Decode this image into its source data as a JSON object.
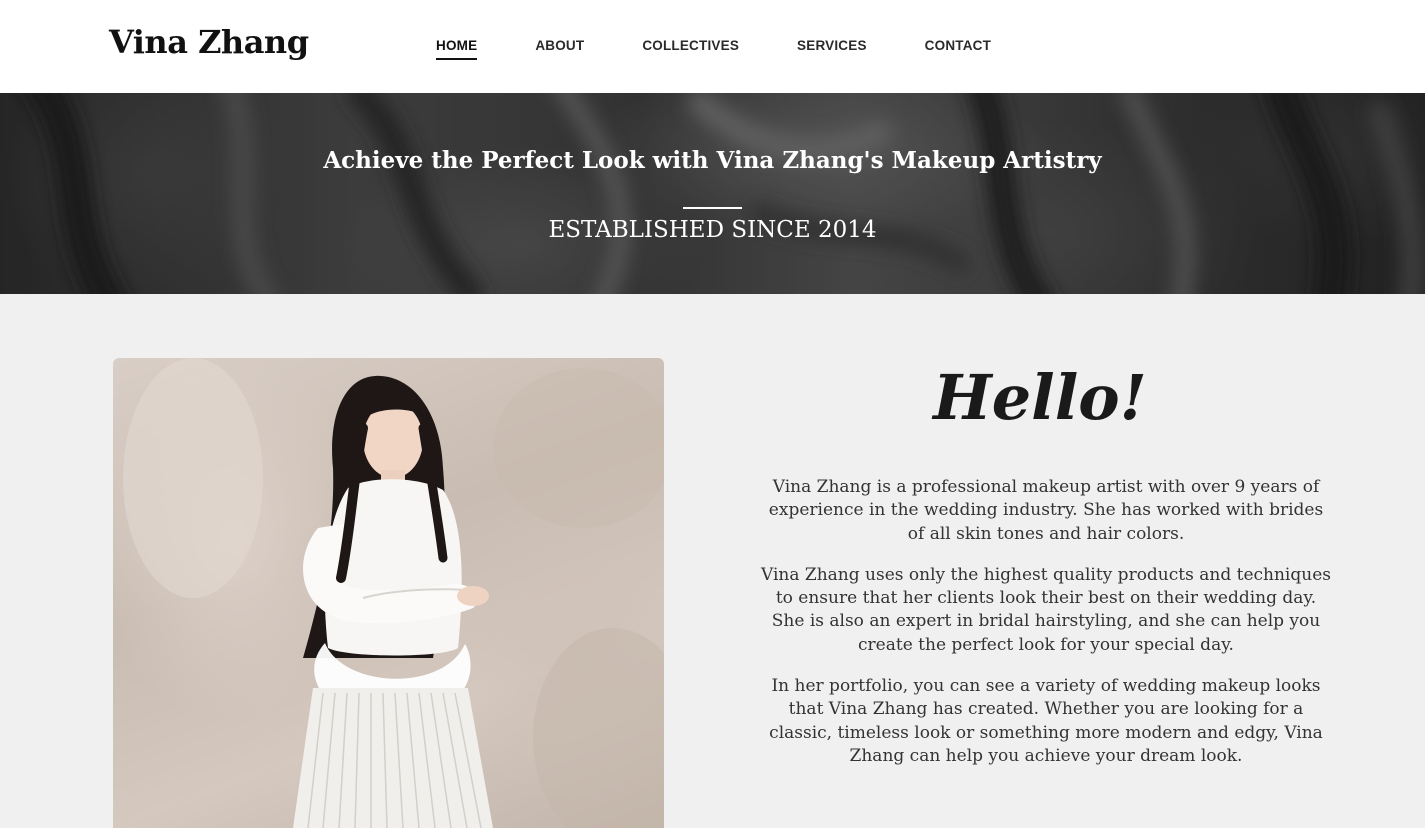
{
  "header": {
    "brand": "Vina Zhang",
    "nav": [
      {
        "label": "HOME",
        "active": true
      },
      {
        "label": "ABOUT",
        "active": false
      },
      {
        "label": "COLLECTIVES",
        "active": false
      },
      {
        "label": "SERVICES",
        "active": false
      },
      {
        "label": "CONTACT",
        "active": false
      }
    ]
  },
  "hero": {
    "title": "Achieve the Perfect Look with Vina Zhang's Makeup Artistry",
    "subtitle": "ESTABLISHED SINCE 2014"
  },
  "intro": {
    "heading": "Hello!",
    "paragraphs": [
      "Vina Zhang is a professional makeup artist with over 9 years of experience in the wedding industry. She has worked with brides of all skin tones and hair colors.",
      "Vina Zhang uses only the highest quality products and techniques to ensure that her clients look their best on their wedding day. She is also an expert in bridal hairstyling, and she can help you create the perfect look for your special day.",
      "In her portfolio, you can see a variety of wedding makeup looks that Vina Zhang has created. Whether you are looking for a classic, timeless look or something more modern and edgy, Vina Zhang can help you achieve your dream look."
    ]
  },
  "colors": {
    "header_bg": "#ffffff",
    "page_bg": "#f0f0f0",
    "text_dark": "#111111",
    "hero_text": "#ffffff"
  }
}
